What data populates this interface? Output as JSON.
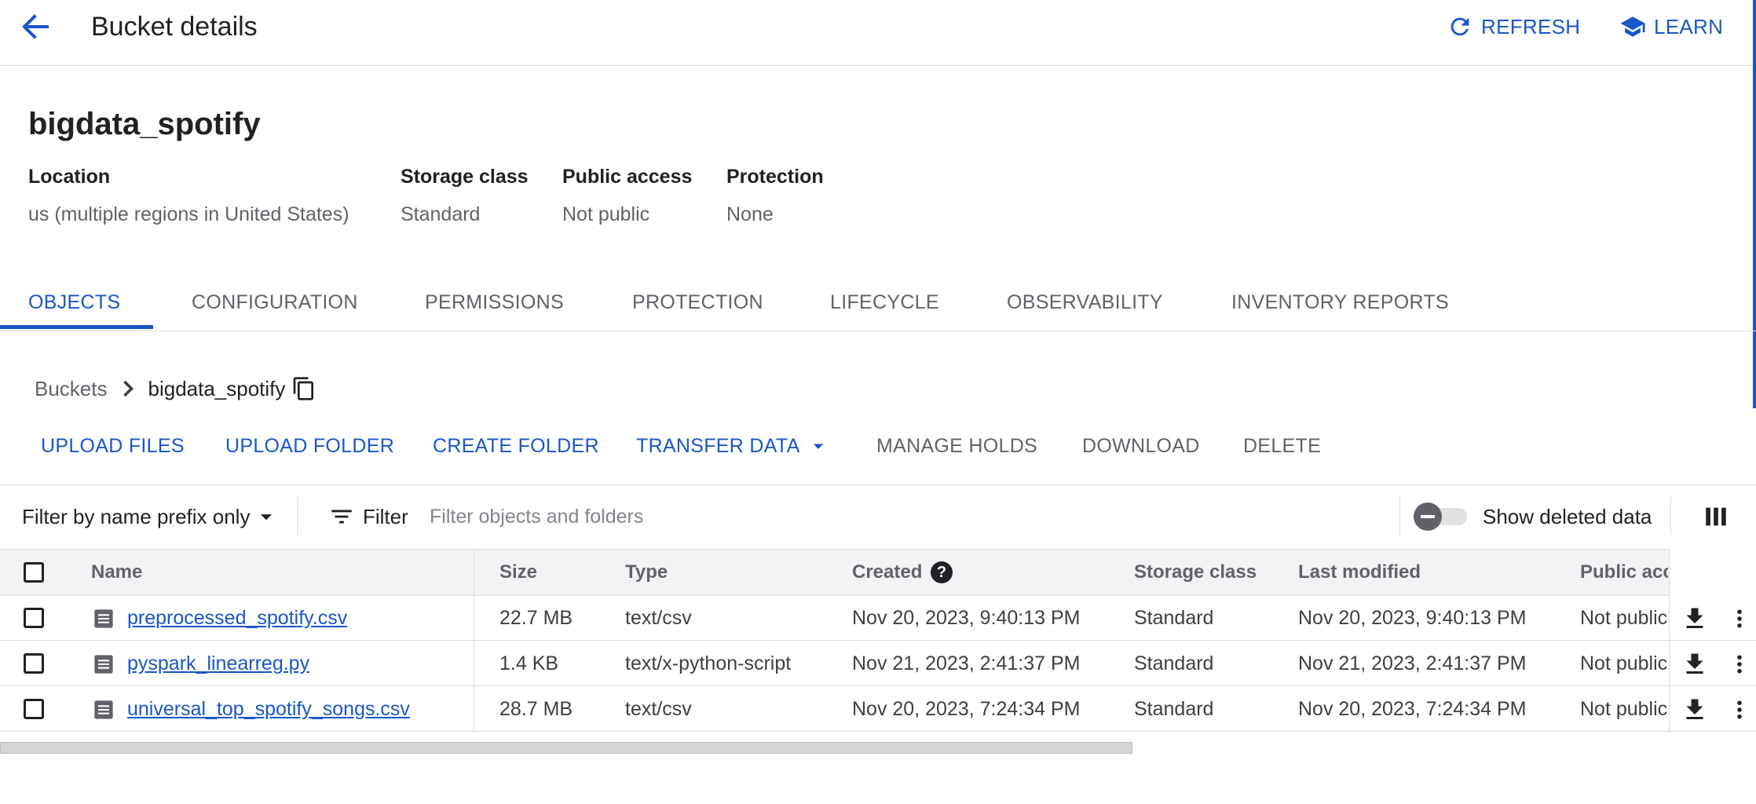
{
  "header": {
    "title": "Bucket details",
    "refresh_label": "REFRESH",
    "learn_label": "LEARN"
  },
  "bucket": {
    "name": "bigdata_spotify",
    "meta": [
      {
        "label": "Location",
        "value": "us (multiple regions in United States)"
      },
      {
        "label": "Storage class",
        "value": "Standard"
      },
      {
        "label": "Public access",
        "value": "Not public"
      },
      {
        "label": "Protection",
        "value": "None"
      }
    ]
  },
  "tabs": [
    {
      "label": "OBJECTS",
      "active": true
    },
    {
      "label": "CONFIGURATION"
    },
    {
      "label": "PERMISSIONS"
    },
    {
      "label": "PROTECTION"
    },
    {
      "label": "LIFECYCLE"
    },
    {
      "label": "OBSERVABILITY"
    },
    {
      "label": "INVENTORY REPORTS"
    }
  ],
  "breadcrumb": {
    "root": "Buckets",
    "current": "bigdata_spotify"
  },
  "actions": {
    "upload_files": "UPLOAD FILES",
    "upload_folder": "UPLOAD FOLDER",
    "create_folder": "CREATE FOLDER",
    "transfer_data": "TRANSFER DATA",
    "manage_holds": "MANAGE HOLDS",
    "download": "DOWNLOAD",
    "delete": "DELETE"
  },
  "filter": {
    "mode": "Filter by name prefix only",
    "filter_label": "Filter",
    "placeholder": "Filter objects and folders",
    "show_deleted_label": "Show deleted data"
  },
  "table": {
    "columns": {
      "name": "Name",
      "size": "Size",
      "type": "Type",
      "created": "Created",
      "storage_class": "Storage class",
      "last_modified": "Last modified",
      "public_access": "Public acc"
    },
    "rows": [
      {
        "name": "preprocessed_spotify.csv",
        "size": "22.7 MB",
        "type": "text/csv",
        "created": "Nov 20, 2023, 9:40:13 PM",
        "storage_class": "Standard",
        "last_modified": "Nov 20, 2023, 9:40:13 PM",
        "public_access": "Not public"
      },
      {
        "name": "pyspark_linearreg.py",
        "size": "1.4 KB",
        "type": "text/x-python-script",
        "created": "Nov 21, 2023, 2:41:37 PM",
        "storage_class": "Standard",
        "last_modified": "Nov 21, 2023, 2:41:37 PM",
        "public_access": "Not public"
      },
      {
        "name": "universal_top_spotify_songs.csv",
        "size": "28.7 MB",
        "type": "text/csv",
        "created": "Nov 20, 2023, 7:24:34 PM",
        "storage_class": "Standard",
        "last_modified": "Nov 20, 2023, 7:24:34 PM",
        "public_access": "Not public"
      }
    ]
  },
  "colors": {
    "accent": "#1a56c8",
    "text": "#202124",
    "muted": "#5f6368",
    "header_bg": "#f1f3f4"
  }
}
